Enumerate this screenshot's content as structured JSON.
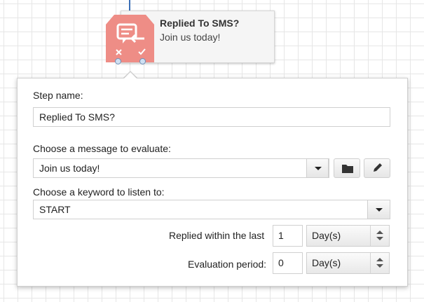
{
  "node": {
    "title": "Replied To SMS?",
    "subtitle": "Join us today!",
    "icon": "sms-reply-icon",
    "color": "#ee8d86"
  },
  "form": {
    "step_name_label": "Step name:",
    "step_name_value": "Replied To SMS?",
    "message_label": "Choose a message to evaluate:",
    "message_value": "Join us today!",
    "keyword_label": "Choose a keyword to listen to:",
    "keyword_value": "START",
    "replied_within_label": "Replied within the last",
    "replied_within_value": "1",
    "replied_within_unit": "Day(s)",
    "evaluation_label": "Evaluation period:",
    "evaluation_value": "0",
    "evaluation_unit": "Day(s)"
  },
  "icons": {
    "message_dropdown": "chevron-down-icon",
    "open_folder": "folder-icon",
    "edit": "pencil-icon",
    "keyword_dropdown": "chevron-down-icon",
    "spinner": "up-down-arrows-icon"
  }
}
